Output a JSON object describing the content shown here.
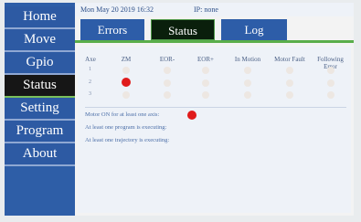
{
  "nav": {
    "items": [
      {
        "label": "Home"
      },
      {
        "label": "Move"
      },
      {
        "label": "Gpio"
      },
      {
        "label": "Status"
      },
      {
        "label": "Setting"
      },
      {
        "label": "Program"
      },
      {
        "label": "About"
      }
    ],
    "active": "Status"
  },
  "topbar": {
    "datetime": "Mon May 20 2019 16:32",
    "ip": "IP: none"
  },
  "tabs": {
    "items": [
      {
        "label": "Errors"
      },
      {
        "label": "Status"
      },
      {
        "label": "Log"
      }
    ],
    "active": "Status"
  },
  "status_table": {
    "headers": [
      "Axe",
      "ZM",
      "EOR-",
      "EOR+",
      "In Motion",
      "Motor Fault",
      "Following Error"
    ],
    "rows": [
      {
        "axis": "1",
        "zm": false,
        "eor_minus": false,
        "eor_plus": false,
        "in_motion": false,
        "motor_fault": false,
        "following_error": false
      },
      {
        "axis": "2",
        "zm": true,
        "eor_minus": false,
        "eor_plus": false,
        "in_motion": false,
        "motor_fault": false,
        "following_error": false
      },
      {
        "axis": "3",
        "zm": false,
        "eor_minus": false,
        "eor_plus": false,
        "in_motion": false,
        "motor_fault": false,
        "following_error": false
      }
    ]
  },
  "info": {
    "motor_on_label": "Motor ON for at least one axis:",
    "motor_on": true,
    "program_label": "At least one program is executing:",
    "trajectory_label": "At least one trajectory is executing:"
  },
  "colors": {
    "nav_bg": "#2d5aa3",
    "active_bg": "#161616",
    "accent_green": "#5aae4a",
    "indicator_on": "#e01b1b",
    "indicator_off": "#ede7e2"
  }
}
